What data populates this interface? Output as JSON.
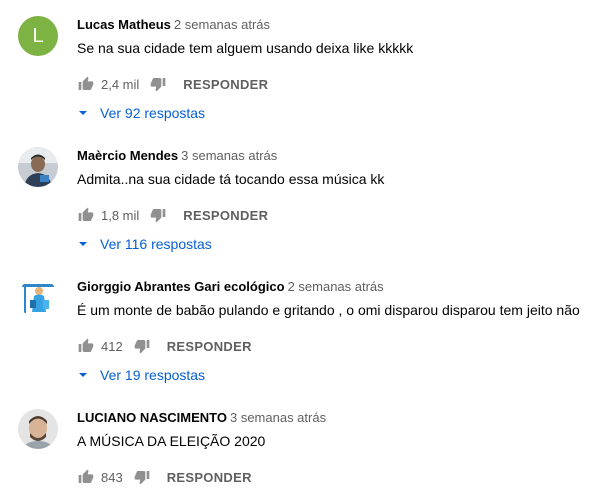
{
  "comments": [
    {
      "author": "Lucas Matheus",
      "time": "2 semanas atrás",
      "text": "Se na sua cidade tem alguem usando deixa like kkkkk",
      "likes": "2,4 mil",
      "reply_label": "RESPONDER",
      "replies_label": "Ver 92 respostas",
      "avatar_letter": "L",
      "avatar_color": "#7cb342"
    },
    {
      "author": "Maèrcio Mendes",
      "time": "3 semanas atrás",
      "text": "Admita..na sua cidade tá tocando essa música kk",
      "likes": "1,8 mil",
      "reply_label": "RESPONDER",
      "replies_label": "Ver 116 respostas"
    },
    {
      "author": "Giorggio Abrantes Gari ecológico",
      "time": "2 semanas atrás",
      "text": "É um monte de babão pulando e gritando , o omi disparou disparou tem jeito não",
      "likes": "412",
      "reply_label": "RESPONDER",
      "replies_label": "Ver 19 respostas"
    },
    {
      "author": "LUCIANO NASCIMENTO",
      "time": "3 semanas atrás",
      "text": "A MÚSICA DA ELEIÇÃO 2020",
      "likes": "843",
      "reply_label": "RESPONDER"
    }
  ],
  "colors": {
    "link": "#065fd4",
    "meta": "#606060",
    "text": "#030303"
  },
  "icons": {
    "like": "thumb-up-icon",
    "dislike": "thumb-down-icon",
    "expand": "chevron-down-icon"
  }
}
